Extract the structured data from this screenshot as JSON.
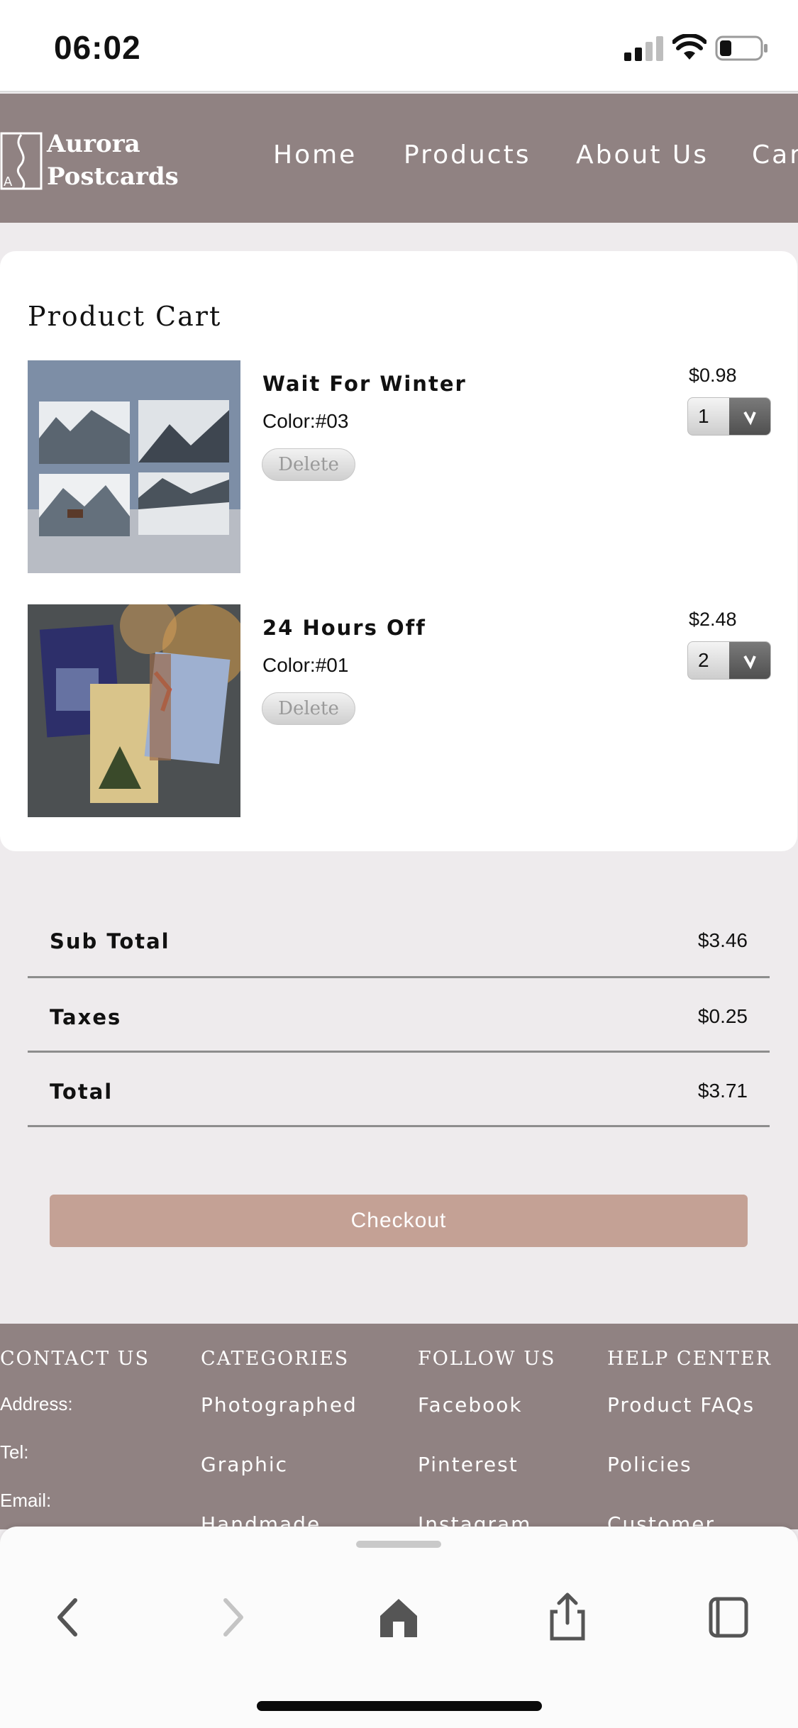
{
  "status_bar": {
    "time": "06:02"
  },
  "header": {
    "logo_line1": "Aurora",
    "logo_line2": "Postcards",
    "nav": [
      "Home",
      "Products",
      "About Us",
      "Cart"
    ]
  },
  "cart": {
    "title": "Product Cart",
    "items": [
      {
        "name": "Wait For Winter",
        "color": "Color:#03",
        "delete_label": "Delete",
        "price": "$0.98",
        "quantity": "1"
      },
      {
        "name": "24 Hours Off",
        "color": "Color:#01",
        "delete_label": "Delete",
        "price": "$2.48",
        "quantity": "2"
      }
    ]
  },
  "totals": [
    {
      "label": "Sub Total",
      "amount": "$3.46"
    },
    {
      "label": "Taxes",
      "amount": "$0.25"
    },
    {
      "label": "Total",
      "amount": "$3.71"
    }
  ],
  "checkout_label": "Checkout",
  "footer": {
    "contact": {
      "heading": "CONTACT US",
      "lines": [
        "Address:",
        "Tel:",
        "Email:"
      ]
    },
    "categories": {
      "heading": "CATEGORIES",
      "links": [
        "Photographed",
        "Graphic",
        "Handmade"
      ]
    },
    "follow": {
      "heading": "FOLLOW US",
      "links": [
        "Facebook",
        "Pinterest",
        "Instagram"
      ]
    },
    "help": {
      "heading": "HELP CENTER",
      "links": [
        "Product FAQs",
        "Policies",
        "Customer Service"
      ]
    }
  },
  "browser_bar": {
    "icons": [
      "back-icon",
      "forward-icon",
      "home-icon",
      "share-icon",
      "tabs-icon"
    ]
  },
  "colors": {
    "header_bg": "#908282",
    "checkout_bg": "#c4a195",
    "page_bg": "#eeebed"
  }
}
